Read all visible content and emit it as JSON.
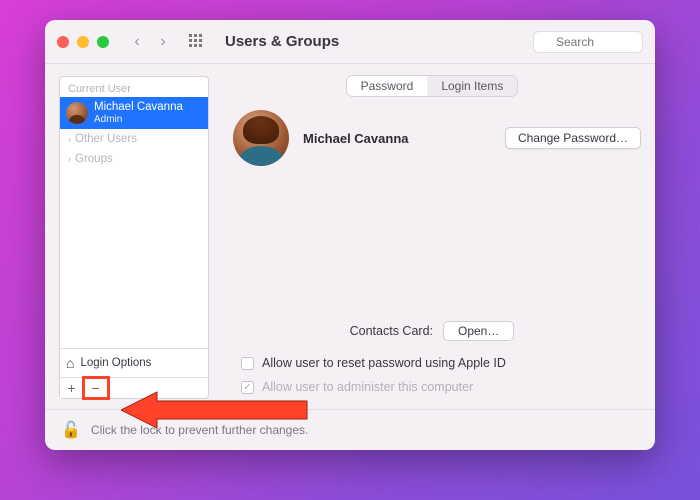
{
  "window": {
    "title": "Users & Groups",
    "search_placeholder": "Search"
  },
  "sidebar": {
    "current_user_label": "Current User",
    "user": {
      "name": "Michael Cavanna",
      "role": "Admin"
    },
    "other_users_label": "Other Users",
    "groups_label": "Groups",
    "login_options_label": "Login Options"
  },
  "tabs": {
    "password": "Password",
    "login_items": "Login Items",
    "active": "password"
  },
  "main": {
    "user_display_name": "Michael Cavanna",
    "change_password_label": "Change Password…",
    "contacts_label": "Contacts Card:",
    "open_label": "Open…",
    "allow_reset_label": "Allow user to reset password using Apple ID",
    "allow_admin_label": "Allow user to administer this computer",
    "allow_admin_checked": true
  },
  "footer": {
    "lock_text": "Click the lock to prevent further changes."
  }
}
